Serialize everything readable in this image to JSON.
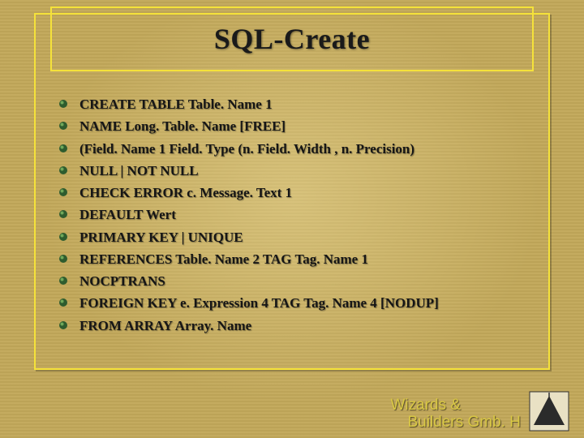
{
  "title": "SQL-Create",
  "bullets": [
    "CREATE TABLE Table. Name 1",
    "NAME Long. Table. Name [FREE]",
    "(Field. Name 1 Field. Type (n. Field. Width , n. Precision)",
    "NULL | NOT NULL",
    "CHECK ERROR c. Message. Text 1",
    "DEFAULT Wert",
    "PRIMARY KEY | UNIQUE",
    "REFERENCES Table. Name 2 TAG Tag. Name 1",
    "NOCPTRANS",
    "FOREIGN KEY e. Expression 4 TAG Tag. Name 4 [NODUP]",
    "FROM ARRAY Array. Name"
  ],
  "footer_line1": "Wizards &",
  "footer_line2": "    Builders Gmb. H",
  "colors": {
    "background": "#c2a85a",
    "border": "#f5e23a",
    "footer_text": "#d9c844"
  }
}
